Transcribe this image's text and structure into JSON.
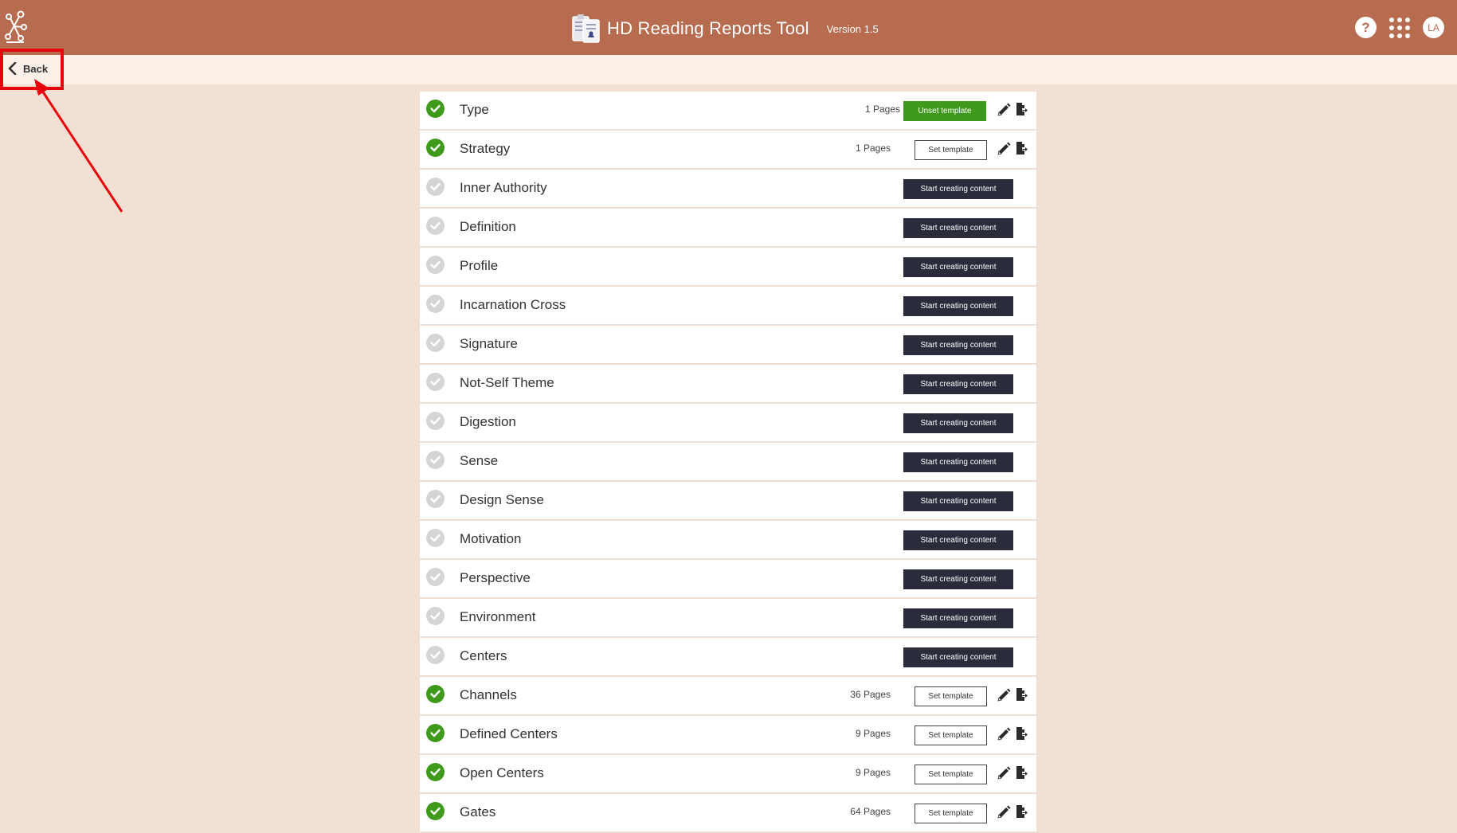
{
  "header": {
    "app_title": "HD Reading Reports Tool",
    "version": "Version 1.5",
    "help_label": "?",
    "avatar_initials": "LA"
  },
  "nav": {
    "back_label": "Back"
  },
  "rows": [
    {
      "name": "Type",
      "done": true,
      "pages": "1 Pages",
      "template": "unset",
      "template_label": "Unset template"
    },
    {
      "name": "Strategy",
      "done": true,
      "pages": "1 Pages",
      "template": "set",
      "template_label": "Set template"
    },
    {
      "name": "Inner Authority",
      "done": false,
      "action_label": "Start creating content"
    },
    {
      "name": "Definition",
      "done": false,
      "action_label": "Start creating content"
    },
    {
      "name": "Profile",
      "done": false,
      "action_label": "Start creating content"
    },
    {
      "name": "Incarnation Cross",
      "done": false,
      "action_label": "Start creating content"
    },
    {
      "name": "Signature",
      "done": false,
      "action_label": "Start creating content"
    },
    {
      "name": "Not-Self Theme",
      "done": false,
      "action_label": "Start creating content"
    },
    {
      "name": "Digestion",
      "done": false,
      "action_label": "Start creating content"
    },
    {
      "name": "Sense",
      "done": false,
      "action_label": "Start creating content"
    },
    {
      "name": "Design Sense",
      "done": false,
      "action_label": "Start creating content"
    },
    {
      "name": "Motivation",
      "done": false,
      "action_label": "Start creating content"
    },
    {
      "name": "Perspective",
      "done": false,
      "action_label": "Start creating content"
    },
    {
      "name": "Environment",
      "done": false,
      "action_label": "Start creating content"
    },
    {
      "name": "Centers",
      "done": false,
      "action_label": "Start creating content"
    },
    {
      "name": "Channels",
      "done": true,
      "pages": "36 Pages",
      "template": "set",
      "template_label": "Set template"
    },
    {
      "name": "Defined Centers",
      "done": true,
      "pages": "9 Pages",
      "template": "set",
      "template_label": "Set template"
    },
    {
      "name": "Open Centers",
      "done": true,
      "pages": "9 Pages",
      "template": "set",
      "template_label": "Set template"
    },
    {
      "name": "Gates",
      "done": true,
      "pages": "64 Pages",
      "template": "set",
      "template_label": "Set template"
    }
  ],
  "colors": {
    "header": "#b76c50",
    "background": "#f2e0d4",
    "subbar": "#fcf0e8",
    "done": "#3f9a1c",
    "todo": "#d5d5d5",
    "dark_button": "#2a2c3b",
    "annotation": "#e8000b"
  }
}
